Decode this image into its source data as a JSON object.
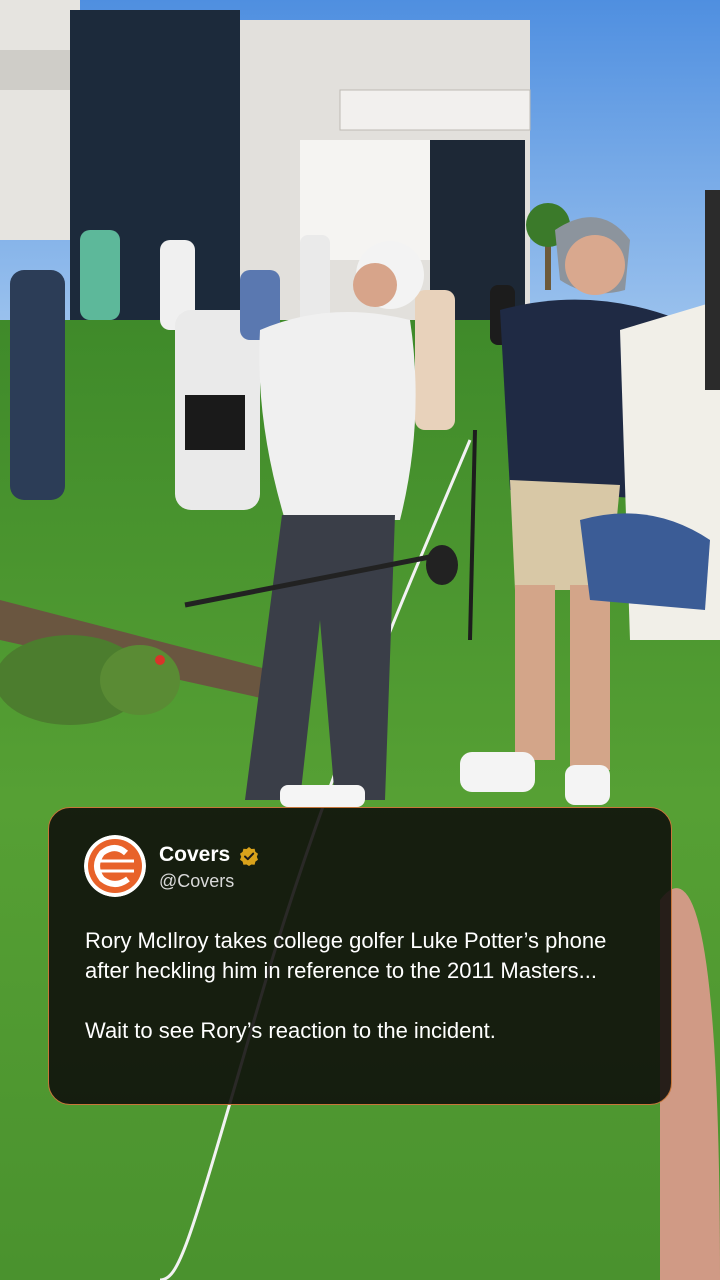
{
  "post": {
    "display_name": "Covers",
    "handle": "@Covers",
    "verified_icon": "verified-badge-icon",
    "avatar_icon": "covers-logo-icon",
    "text_paragraphs": [
      "Rory McIlroy takes college golfer Luke Potter’s phone after heckling him in reference to the 2011 Masters...",
      "Wait to see Rory’s reaction to the incident."
    ]
  },
  "colors": {
    "accent": "#e8622a",
    "card_border": "#c7763a",
    "verified": "#d9a21b",
    "card_background": "#0e0c0a"
  }
}
